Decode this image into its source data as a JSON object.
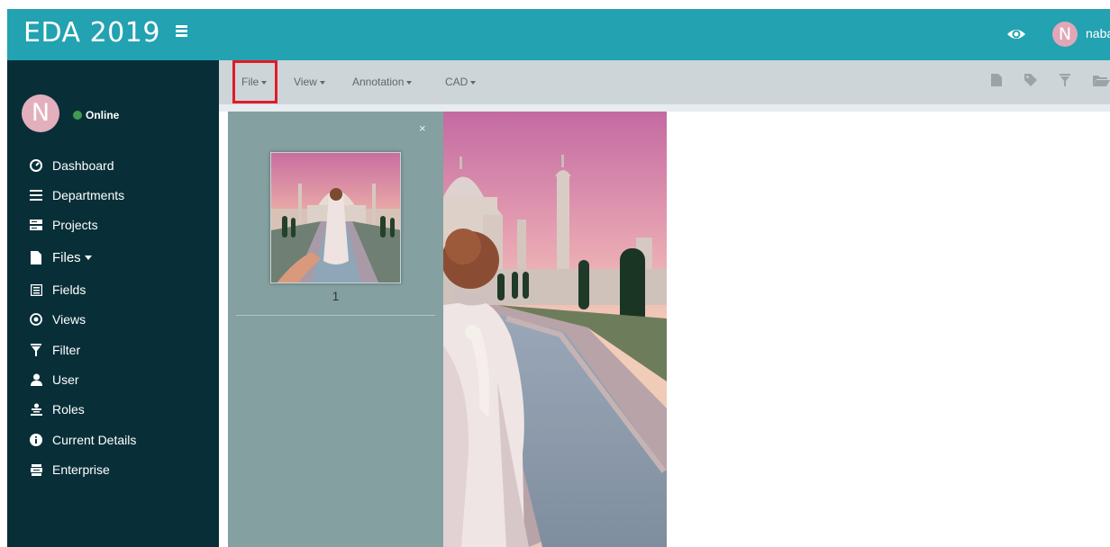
{
  "header": {
    "brand": "EDA 2019",
    "user_initial": "N",
    "user_name": "naba"
  },
  "sidebar": {
    "avatar_initial": "N",
    "status": "Online",
    "items": [
      {
        "label": "Dashboard",
        "icon": "dashboard-icon"
      },
      {
        "label": "Departments",
        "icon": "list-icon"
      },
      {
        "label": "Projects",
        "icon": "projects-icon"
      },
      {
        "label": "Files",
        "icon": "file-icon"
      },
      {
        "label": "Fields",
        "icon": "fields-icon"
      },
      {
        "label": "Views",
        "icon": "views-icon"
      },
      {
        "label": "Filter",
        "icon": "filter-icon"
      },
      {
        "label": "User",
        "icon": "user-icon"
      },
      {
        "label": "Roles",
        "icon": "roles-icon"
      },
      {
        "label": "Current Details",
        "icon": "info-icon"
      },
      {
        "label": "Enterprise",
        "icon": "enterprise-icon"
      }
    ]
  },
  "toolbar": {
    "menus": [
      {
        "label": "File"
      },
      {
        "label": "View"
      },
      {
        "label": "Annotation"
      },
      {
        "label": "CAD"
      }
    ],
    "icons": [
      "new-file-icon",
      "tag-icon",
      "filter-icon",
      "folder-open-icon"
    ]
  },
  "viewer": {
    "close_symbol": "×",
    "page_number": "1"
  },
  "colors": {
    "header": "#23a2b1",
    "sidebar": "#082f38",
    "toolbar": "#cdd5d9",
    "thumb_panel": "#84a0a0",
    "highlight": "#e21b26"
  }
}
